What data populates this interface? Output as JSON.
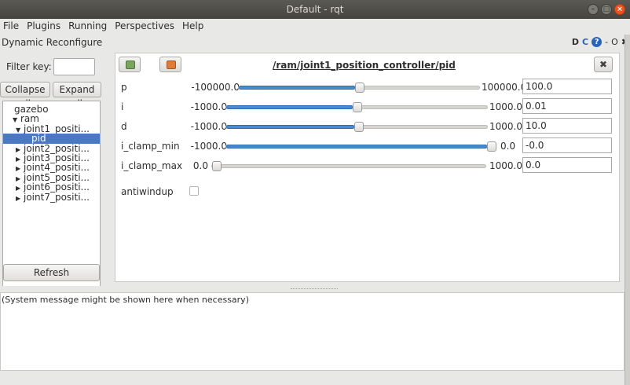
{
  "window": {
    "title": "Default - rqt"
  },
  "menubar": {
    "items": [
      "File",
      "Plugins",
      "Running",
      "Perspectives",
      "Help"
    ]
  },
  "dock": {
    "title": "Dynamic Reconfigure",
    "icons": {
      "d": "D",
      "reload": "C",
      "help": "?",
      "minimize": "-",
      "float": "O",
      "close": "✖"
    }
  },
  "left": {
    "filter_label": "Filter key:",
    "filter_value": "",
    "collapse_label": "Collapse all",
    "expand_label": "Expand all",
    "tree": [
      {
        "label": "gazebo",
        "indent": 0,
        "arrow": ""
      },
      {
        "label": "ram",
        "indent": 0,
        "arrow": "▼"
      },
      {
        "label": "joint1_positi...",
        "indent": 1,
        "arrow": "▼"
      },
      {
        "label": "pid",
        "indent": 2,
        "arrow": "",
        "selected": true
      },
      {
        "label": "joint2_positi...",
        "indent": 1,
        "arrow": "▶"
      },
      {
        "label": "joint3_positi...",
        "indent": 1,
        "arrow": "▶"
      },
      {
        "label": "joint4_positi...",
        "indent": 1,
        "arrow": "▶"
      },
      {
        "label": "joint5_positi...",
        "indent": 1,
        "arrow": "▶"
      },
      {
        "label": "joint6_positi...",
        "indent": 1,
        "arrow": "▶"
      },
      {
        "label": "joint7_positi...",
        "indent": 1,
        "arrow": "▶"
      }
    ],
    "refresh_label": "Refresh"
  },
  "main": {
    "node_path": "/ram/joint1_position_controller/pid",
    "close_label": "✖",
    "params": [
      {
        "name": "p",
        "min": "-100000.0",
        "max": "100000.0",
        "value": "100.0",
        "fraction": 0.5005
      },
      {
        "name": "i",
        "min": "-1000.0",
        "max": "1000.0",
        "value": "0.01",
        "fraction": 0.5
      },
      {
        "name": "d",
        "min": "-1000.0",
        "max": "1000.0",
        "value": "10.0",
        "fraction": 0.505
      },
      {
        "name": "i_clamp_min",
        "min": "-1000.0",
        "max": "0.0",
        "value": "-0.0",
        "fraction": 1.0
      },
      {
        "name": "i_clamp_max",
        "min": "0.0",
        "max": "1000.0",
        "value": "0.0",
        "fraction": 0.0
      }
    ],
    "antiwindup_label": "antiwindup",
    "antiwindup_checked": false
  },
  "status": {
    "message": "(System message might be shown here when necessary)"
  },
  "colors": {
    "accent": "#e95420",
    "selection": "#4a78c2",
    "slider_fill": "#4a8ad0"
  }
}
